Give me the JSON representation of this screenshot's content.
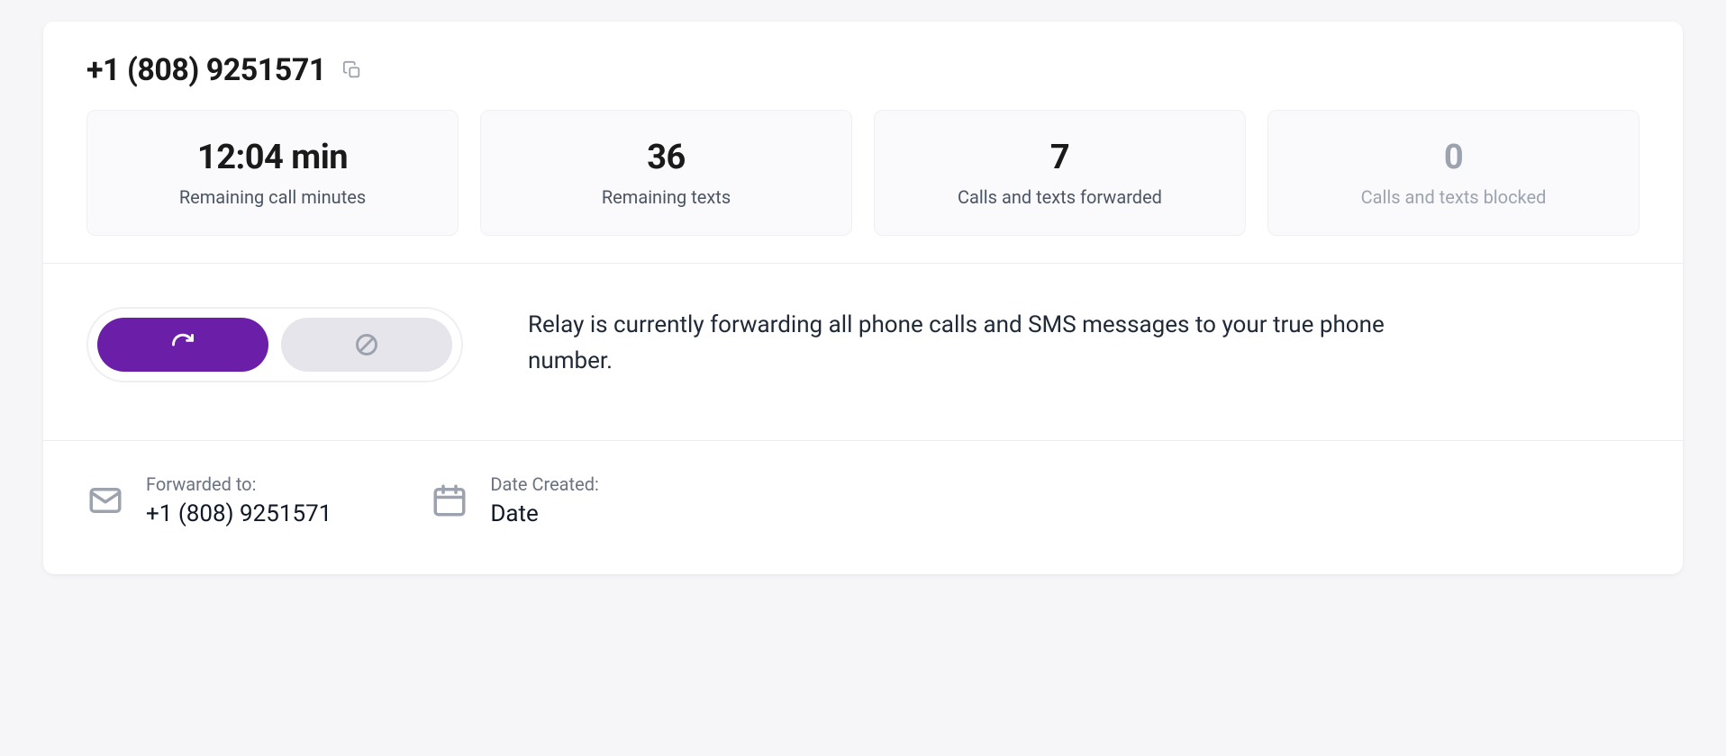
{
  "header": {
    "phone_number": "+1 (808) 9251571"
  },
  "stats": [
    {
      "value": "12:04 min",
      "label": "Remaining call minutes",
      "muted": false
    },
    {
      "value": "36",
      "label": "Remaining texts",
      "muted": false
    },
    {
      "value": "7",
      "label": "Calls and texts forwarded",
      "muted": false
    },
    {
      "value": "0",
      "label": "Calls and texts blocked",
      "muted": true
    }
  ],
  "toggle": {
    "description": "Relay is currently forwarding all phone calls and SMS messages to your true phone number."
  },
  "details": {
    "forwarded": {
      "label": "Forwarded to:",
      "value": "+1 (808) 9251571"
    },
    "created": {
      "label": "Date Created:",
      "value": "Date"
    }
  }
}
